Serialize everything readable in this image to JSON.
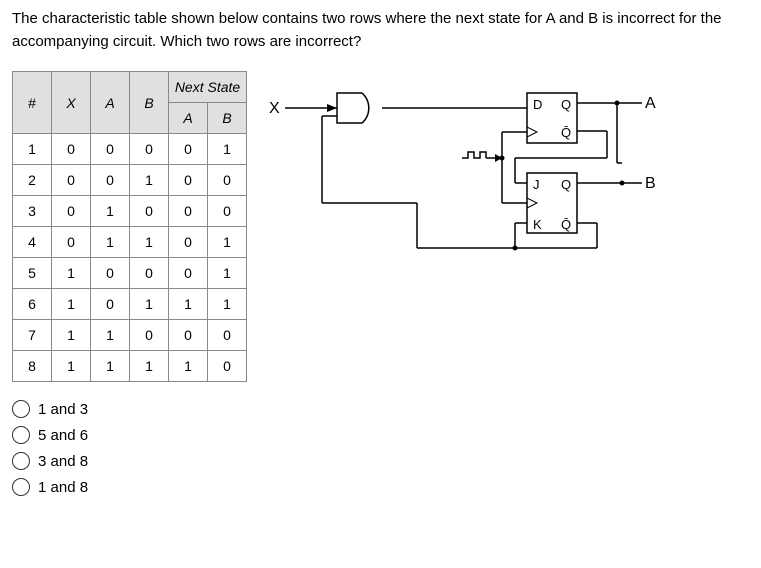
{
  "question": "The characteristic table shown below contains two rows where the next state for A and B is incorrect for the accompanying circuit. Which two rows are incorrect?",
  "table": {
    "headers": {
      "hash": "#",
      "x": "X",
      "a": "A",
      "b": "B",
      "next": "Next State",
      "nextA": "A",
      "nextB": "B"
    },
    "rows": [
      {
        "n": "1",
        "x": "0",
        "a": "0",
        "b": "0",
        "na": "0",
        "nb": "1"
      },
      {
        "n": "2",
        "x": "0",
        "a": "0",
        "b": "1",
        "na": "0",
        "nb": "0"
      },
      {
        "n": "3",
        "x": "0",
        "a": "1",
        "b": "0",
        "na": "0",
        "nb": "0"
      },
      {
        "n": "4",
        "x": "0",
        "a": "1",
        "b": "1",
        "na": "0",
        "nb": "1"
      },
      {
        "n": "5",
        "x": "1",
        "a": "0",
        "b": "0",
        "na": "0",
        "nb": "1"
      },
      {
        "n": "6",
        "x": "1",
        "a": "0",
        "b": "1",
        "na": "1",
        "nb": "1"
      },
      {
        "n": "7",
        "x": "1",
        "a": "1",
        "b": "0",
        "na": "0",
        "nb": "0"
      },
      {
        "n": "8",
        "x": "1",
        "a": "1",
        "b": "1",
        "na": "1",
        "nb": "0"
      }
    ]
  },
  "options": [
    "1 and 3",
    "5 and 6",
    "3 and 8",
    "1 and 8"
  ],
  "circuit": {
    "inputs": {
      "x": "X"
    },
    "outputs": {
      "a": "A",
      "b": "B"
    },
    "flipflops": {
      "d": {
        "d": "D",
        "q": "Q",
        "qbar": "Q̄"
      },
      "jk": {
        "j": "J",
        "k": "K",
        "q": "Q",
        "qbar": "Q̄"
      }
    },
    "clock": "⎍⎍"
  }
}
